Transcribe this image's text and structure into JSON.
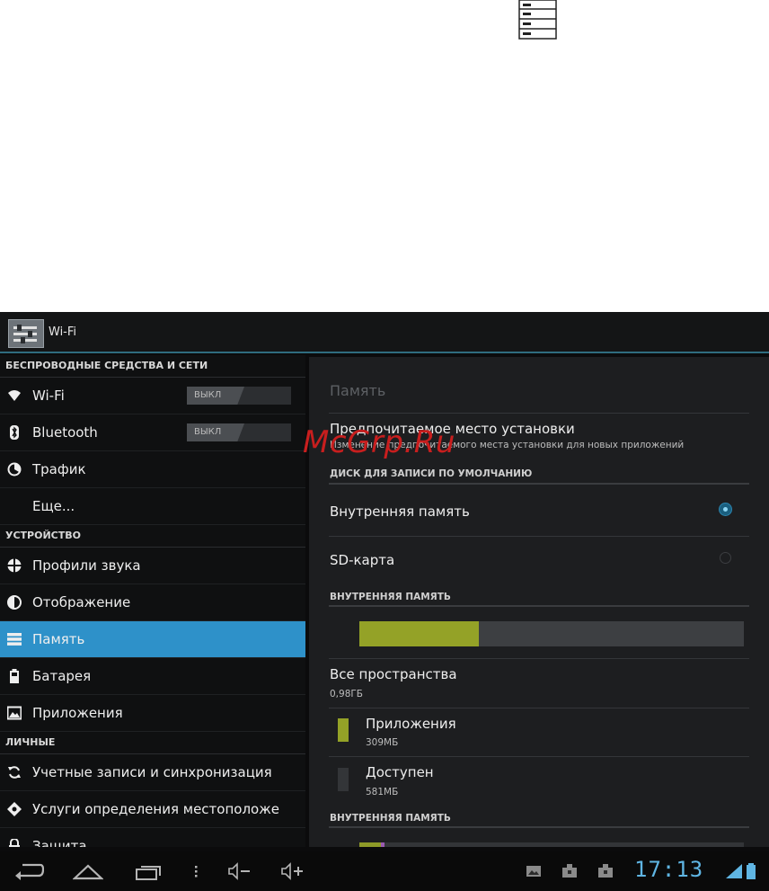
{
  "watermark": "McGrp.Ru",
  "actionbar": {
    "title": "Wi-Fi"
  },
  "sidebar": {
    "wireless_header": "БЕСПРОВОДНЫЕ СРЕДСТВА И СЕТИ",
    "wifi": {
      "label": "Wi-Fi",
      "toggle": "ВЫКЛ"
    },
    "bluetooth": {
      "label": "Bluetooth",
      "toggle": "ВЫКЛ"
    },
    "traffic": "Трафик",
    "more": "Еще...",
    "device_header": "УСТРОЙСТВО",
    "sound": "Профили звука",
    "display": "Отображение",
    "memory": "Память",
    "battery": "Батарея",
    "apps": "Приложения",
    "personal_header": "ЛИЧНЫЕ",
    "accounts": "Учетные записи и синхронизация",
    "location": "Услуги определения местоположе",
    "security": "Защита"
  },
  "content": {
    "title": "Память",
    "install": {
      "title": "Предпочитаемое место установки",
      "summary": "Изменение предпочитаемого места установки для новых приложений"
    },
    "default_disk_header": "ДИСК ДЛЯ ЗАПИСИ ПО УМОЛЧАНИЮ",
    "internal_option": "Внутренняя память",
    "sd_option": "SD-карта",
    "internal_header": "ВНУТРЕННЯЯ ПАМЯТЬ",
    "usage_fraction": 0.31,
    "total": {
      "label": "Все пространства",
      "value": "0,98ГБ"
    },
    "apps": {
      "label": "Приложения",
      "value": "309МБ"
    },
    "free": {
      "label": "Доступен",
      "value": "581МБ"
    },
    "internal_header2": "ВНУТРЕННЯЯ ПАМЯТЬ",
    "second_bar": {
      "green": 0.055,
      "purple": 0.01
    }
  },
  "statusbar": {
    "time": "17:13"
  },
  "colors": {
    "accent": "#2e91c9",
    "clock": "#5fb5e3",
    "usage": "#94a227"
  }
}
